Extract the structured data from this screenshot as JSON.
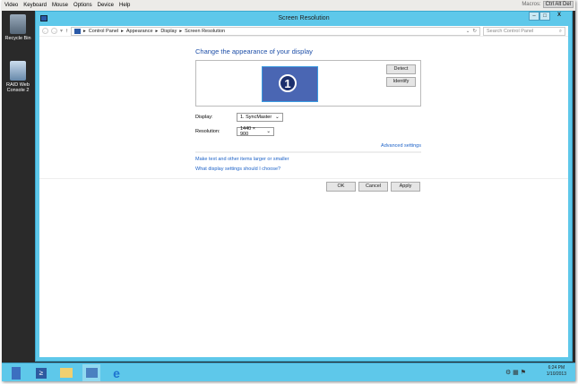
{
  "menubar": {
    "items": [
      "Video",
      "Keyboard",
      "Mouse",
      "Options",
      "Device",
      "Help"
    ],
    "macros_label": "Macros:",
    "cad_button": "Ctrl Alt Del"
  },
  "desktop": {
    "icons": [
      "Recycle Bin",
      "RAID Web Console 2"
    ]
  },
  "window": {
    "title": "Screen Resolution",
    "minimize": "–",
    "maximize": "□",
    "close": "X"
  },
  "address": {
    "crumbs": [
      "Control Panel",
      "Appearance",
      "Display",
      "Screen Resolution"
    ],
    "search_placeholder": "Search Control Panel"
  },
  "main": {
    "heading": "Change the appearance of your display",
    "monitor_number": "1",
    "detect": "Detect",
    "identify": "Identify",
    "display_label": "Display:",
    "display_value": "1. SyncMaster",
    "resolution_label": "Resolution:",
    "resolution_value": "1440 × 900",
    "advanced": "Advanced settings",
    "link1": "Make text and other items larger or smaller",
    "link2": "What display settings should I choose?",
    "ok": "OK",
    "cancel": "Cancel",
    "apply": "Apply"
  },
  "taskbar": {
    "time": "6:24 PM",
    "date": "1/10/2013"
  }
}
